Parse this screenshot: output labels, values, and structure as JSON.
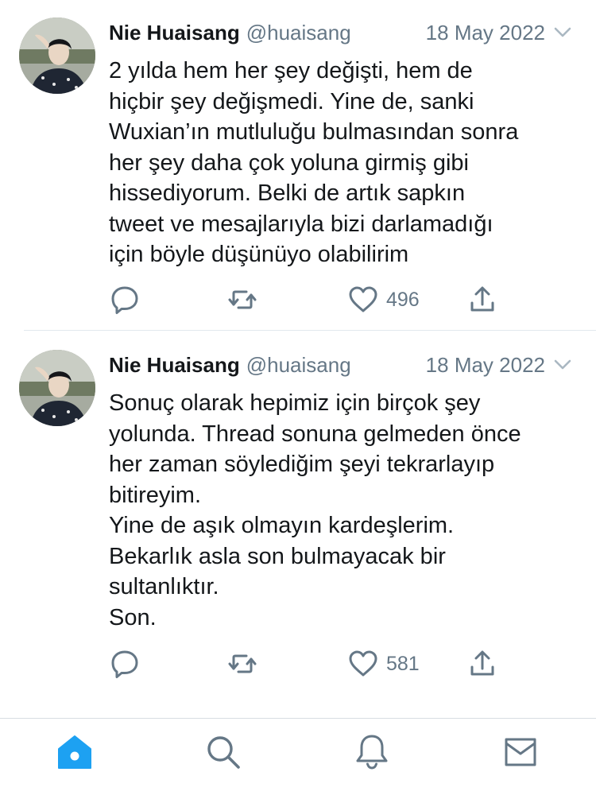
{
  "tweets": [
    {
      "author_name": "Nie Huaisang",
      "handle": "@huaisang",
      "date": "18 May 2022",
      "text": "2 yılda hem her şey değişti, hem de\nhiçbir şey değişmedi. Yine de, sanki\nWuxian’ın mutluluğu bulmasından sonra\nher şey daha çok yoluna girmiş gibi\nhissediyorum. Belki de artık sapkın\ntweet ve mesajlarıyla bizi darlamadığı\niçin böyle düşünüyo olabilirim",
      "like_count": "496"
    },
    {
      "author_name": "Nie Huaisang",
      "handle": "@huaisang",
      "date": "18 May 2022",
      "text": "Sonuç olarak hepimiz için birçok şey\nyolunda. Thread sonuna gelmeden önce\nher zaman söylediğim şeyi tekrarlayıp\nbitireyim.\nYine de aşık olmayın kardeşlerim.\nBekarlık asla son bulmayacak bir\nsultanlıktır.\nSon.",
      "like_count": "581"
    }
  ],
  "icons": {
    "reply": "reply-icon",
    "retweet": "retweet-icon",
    "like": "heart-icon",
    "share": "share-icon",
    "caret": "chevron-down-icon",
    "tab_home": "home-icon",
    "tab_search": "search-icon",
    "tab_notifications": "bell-icon",
    "tab_messages": "mail-icon"
  },
  "colors": {
    "accent": "#1da1f2",
    "icon_gray": "#657786",
    "text": "#14171a",
    "divider": "#e1e8ed"
  }
}
